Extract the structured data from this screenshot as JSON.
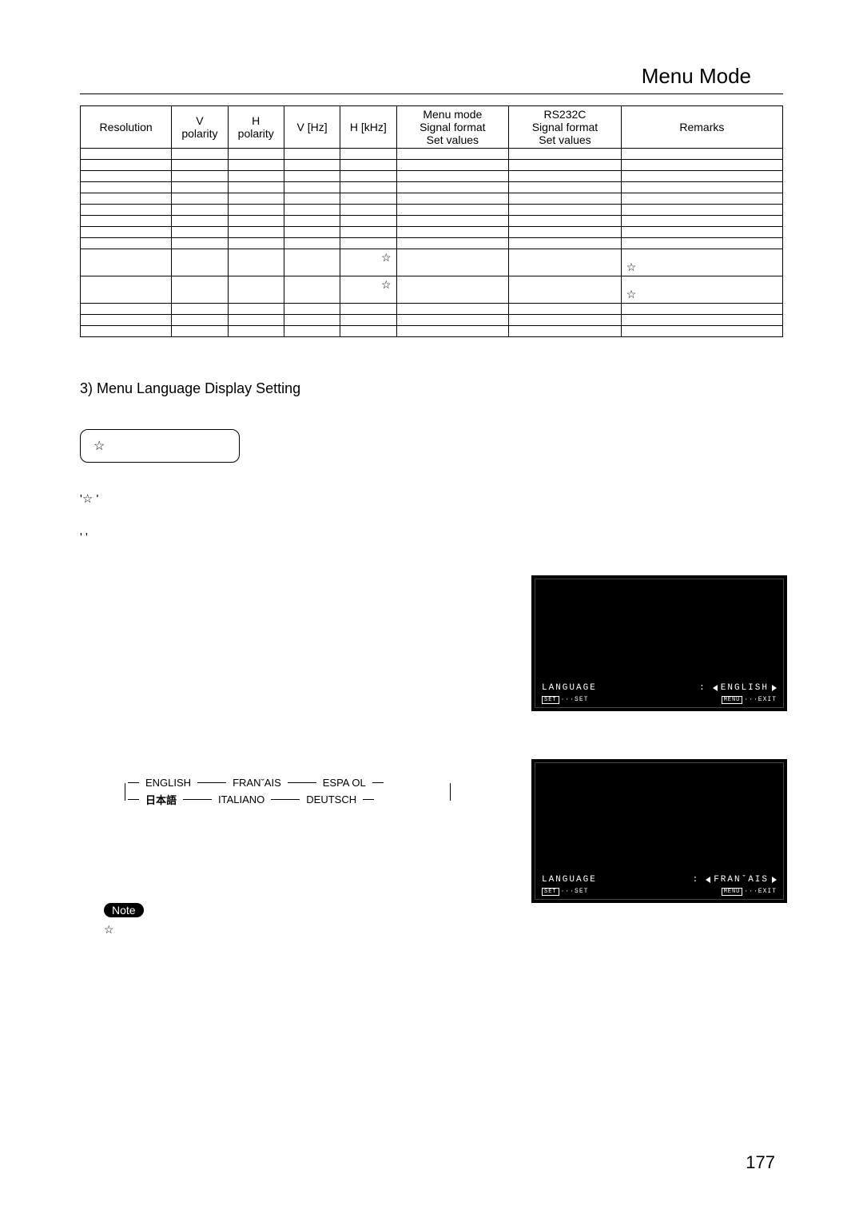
{
  "header": {
    "title": "Menu Mode"
  },
  "table": {
    "headers": [
      "Resolution",
      "V\npolarity",
      "H\npolarity",
      "V [Hz]",
      "H [kHz]",
      "Menu mode\nSignal format\nSet values",
      "RS232C\nSignal format\nSet values",
      "Remarks"
    ],
    "star": "☆"
  },
  "section3": {
    "heading": "3) Menu Language Display Setting",
    "box_label": "☆",
    "paragraph": "      '☆        '\n\n                                               '                         '",
    "star_note": "☆"
  },
  "languages": {
    "row1": [
      "ENGLISH",
      "FRANˇAIS",
      "ESPA OL"
    ],
    "row2": [
      "日本語",
      "ITALIANO",
      "DEUTSCH"
    ]
  },
  "osd1": {
    "label": "LANGUAGE",
    "value": "ENGLISH",
    "set": "SET",
    "set_action": "SET",
    "menu": "MENU",
    "exit": "EXIT"
  },
  "osd2": {
    "label": "LANGUAGE",
    "value": "FRANˇAIS",
    "set": "SET",
    "set_action": "SET",
    "menu": "MENU",
    "exit": "EXIT"
  },
  "note": {
    "label": "Note"
  },
  "page_number": "177"
}
